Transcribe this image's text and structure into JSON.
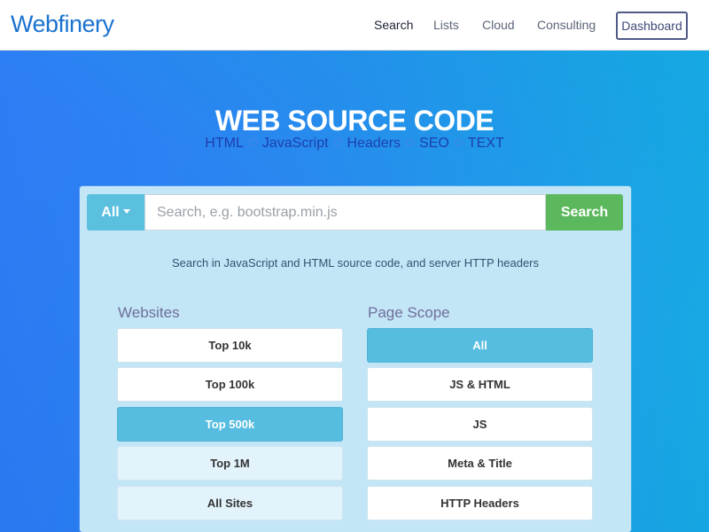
{
  "nav": {
    "logo": "Webfinery",
    "links": [
      "Search",
      "Lists",
      "Cloud",
      "Consulting"
    ],
    "dashboard": "Dashboard"
  },
  "hero": {
    "title": "WEB SOURCE CODE",
    "subtitle_items": [
      "HTML",
      "JavaScript",
      "Headers",
      "SEO",
      "TEXT"
    ]
  },
  "search": {
    "scope_label": "All",
    "placeholder": "Search, e.g. bootstrap.min.js",
    "button": "Search",
    "helper": "Search in JavaScript and HTML source code, and server HTTP headers"
  },
  "websites": {
    "heading": "Websites",
    "options": [
      "Top 10k",
      "Top 100k",
      "Top 500k",
      "Top 1M",
      "All Sites"
    ],
    "selected": "Top 500k"
  },
  "page_scope": {
    "heading": "Page Scope",
    "options": [
      "All",
      "JS & HTML",
      "JS",
      "Meta & Title",
      "HTTP Headers"
    ],
    "selected": "All"
  },
  "colors": {
    "brand": "#1a72cf",
    "selected": "#57bde0",
    "search_button": "#5cb85c"
  }
}
